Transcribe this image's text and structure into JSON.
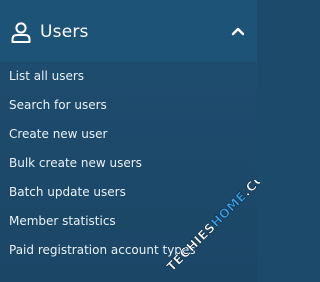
{
  "header": {
    "title": "Users",
    "icon": "user-icon",
    "toggle_icon": "chevron-up-icon"
  },
  "menu": {
    "items": [
      {
        "label": "List all users"
      },
      {
        "label": "Search for users"
      },
      {
        "label": "Create new user"
      },
      {
        "label": "Bulk create new users"
      },
      {
        "label": "Batch update users"
      },
      {
        "label": "Member statistics"
      },
      {
        "label": "Paid registration account types"
      }
    ]
  },
  "watermark": {
    "text_part1": "TECHIES",
    "text_part2": "HOME",
    "text_part3": ".COM"
  },
  "colors": {
    "panel_bg": "#1c4a6b",
    "header_bg": "#1e5378",
    "text": "#ffffff",
    "watermark_accent": "#3aa0e8"
  }
}
